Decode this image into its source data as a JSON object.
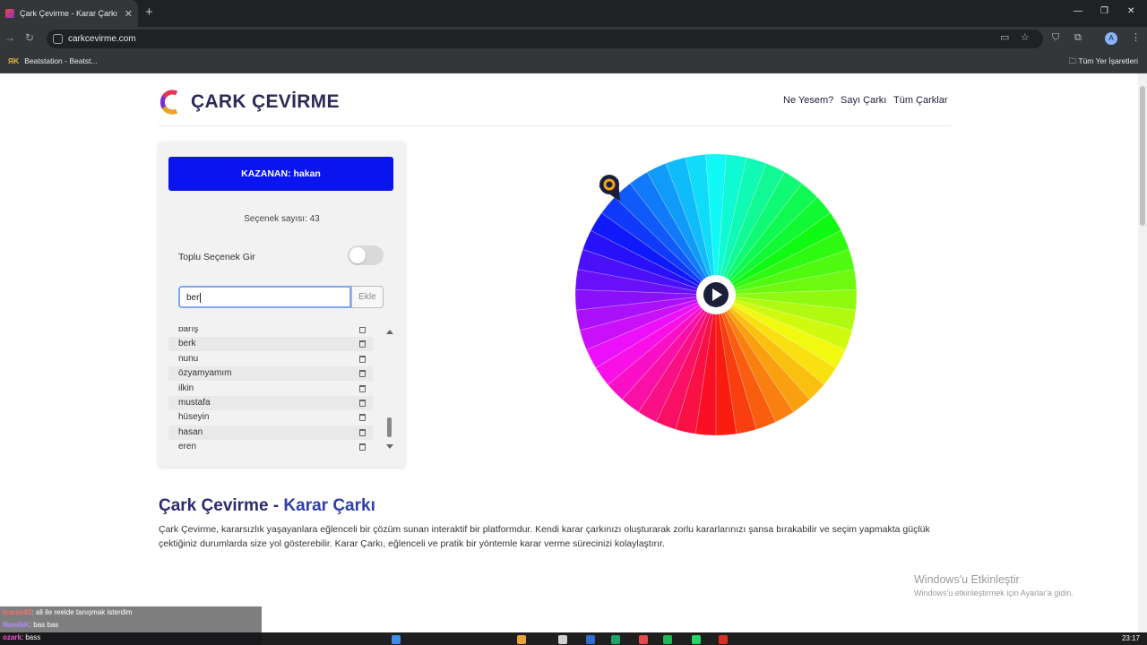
{
  "browser": {
    "tab_title": "Çark Çevirme - Karar Çarkı",
    "tab_close": "✕",
    "new_tab": "+",
    "url": "carkcevirme.com",
    "bookmark_left": "Beatstation - Beatst...",
    "bookmark_left_icon": "ЯK",
    "bookmark_right": "Tüm Yer İşaretleri"
  },
  "header": {
    "brand": "ÇARK ÇEVİRME",
    "nav": [
      "Ne Yesem?",
      "Sayı Çarkı",
      "Tüm Çarklar"
    ]
  },
  "panel": {
    "winner_label": "KAZANAN: hakan",
    "option_count": "Seçenek sayısı: 43",
    "bulk_toggle_label": "Toplu Seçenek Gir",
    "bulk_toggle_on": false,
    "input_value": "ber",
    "add_button": "Ekle",
    "options": [
      "barış",
      "berk",
      "nunu",
      "özyamyamım",
      "ilkin",
      "mustafa",
      "hüseyin",
      "hasan",
      "eren"
    ]
  },
  "wheel": {
    "segments": 43,
    "play_icon": "play-icon"
  },
  "content": {
    "title_main": "Çark Çevirme - ",
    "title_accent": "Karar Çarkı",
    "description": "Çark Çevirme, kararsızlık yaşayanlara eğlenceli bir çözüm sunan interaktif bir platformdur. Kendi karar çarkınızı oluşturarak zorlu kararlarınızı şansa bırakabilir ve seçim yapmakta güçlük çektiğiniz durumlarda size yol gösterebilir. Karar Çarkı, eğlenceli ve pratik bir yöntemle karar verme sürecinizi kolaylaştırır."
  },
  "windows_activation": {
    "line1": "Windows'u Etkinleştir",
    "line2": "Windows'u etkinleştirmek için Ayarlar'a gidin."
  },
  "chat": [
    {
      "user": "Icarus92",
      "text": ": ali ile reelde tanışmak isterdim",
      "color": "#ff6b6b"
    },
    {
      "user": "NamikK",
      "text": ": bas bas",
      "color": "#b48cff"
    },
    {
      "user": "ozark",
      "text": ": bass",
      "color": "#ff4fd8"
    }
  ],
  "taskbar": {
    "clock": "23:17"
  },
  "colors": {
    "brand": "#2b2b58",
    "winner_bg": "#0a14ef",
    "input_border": "#7da7f0"
  }
}
